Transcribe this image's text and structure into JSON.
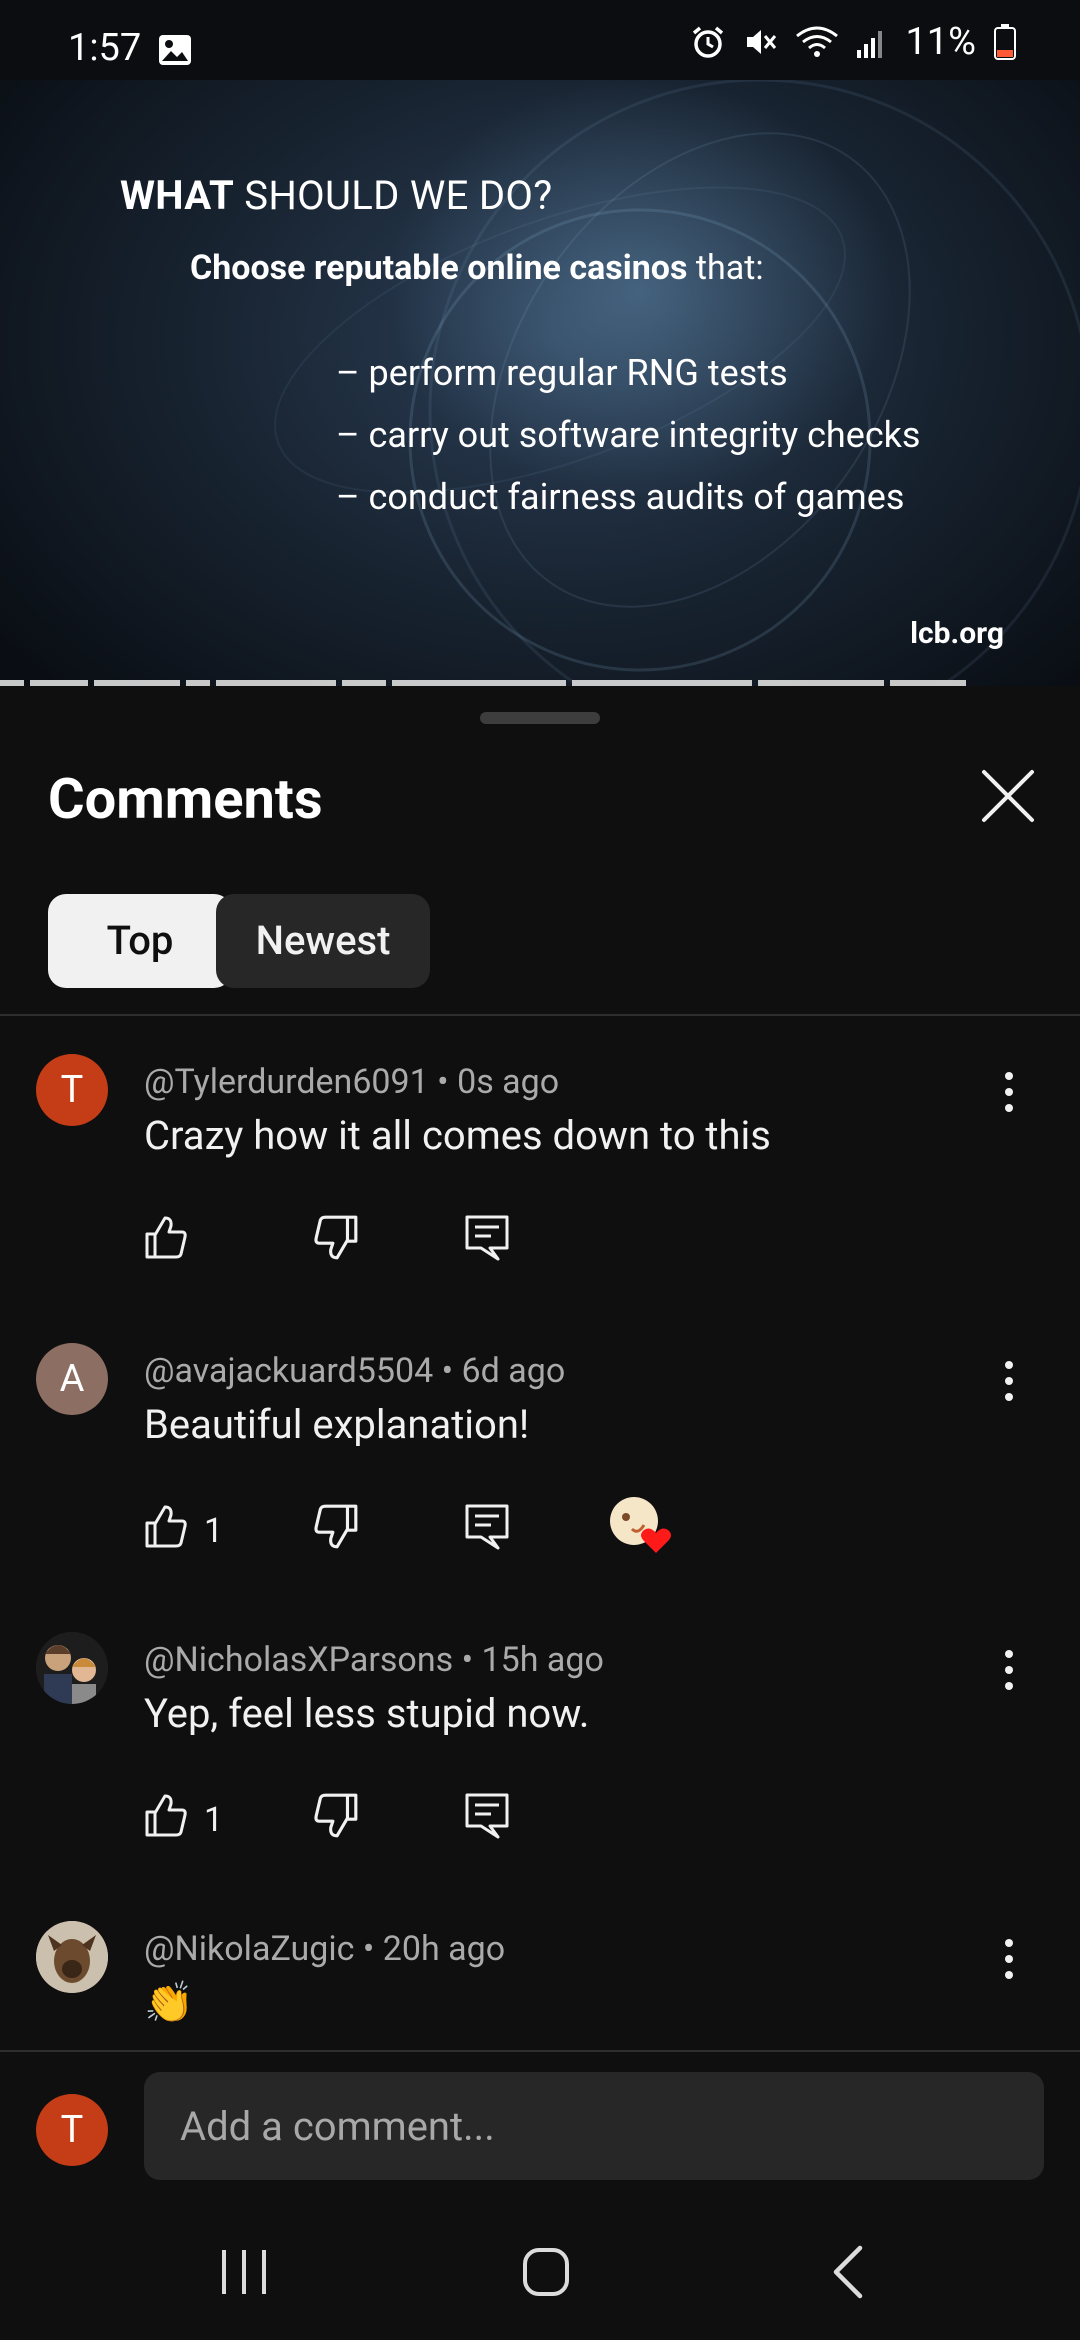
{
  "status_bar": {
    "time": "1:57",
    "battery": "11%",
    "icons": [
      "gallery-icon",
      "alarm-icon",
      "mute-icon",
      "wifi-icon",
      "signal-icon",
      "battery-icon"
    ],
    "battery_color": "#ff5a36"
  },
  "video": {
    "title_bold": "WHAT",
    "title_rest": " SHOULD WE DO?",
    "subtitle_bold": "Choose reputable online casinos",
    "subtitle_rest": " that:",
    "bullets": [
      "– perform regular RNG tests",
      "– carry out software integrity checks",
      "– conduct fairness audits of games"
    ],
    "brand": "lcb.org"
  },
  "comments_panel": {
    "title": "Comments",
    "tabs": [
      {
        "label": "Top",
        "selected": true
      },
      {
        "label": "Newest",
        "selected": false
      }
    ],
    "items": [
      {
        "avatar_letter": "T",
        "avatar_color": "#c43d17",
        "meta": "@Tylerdurden6091 • 0s ago",
        "text": "Crazy how it all comes down to this",
        "likes": "",
        "creator_heart": false
      },
      {
        "avatar_letter": "A",
        "avatar_color": "#8d6e63",
        "meta": "@avajackuard5504 • 6d ago",
        "text": "Beautiful explanation!",
        "likes": "1",
        "creator_heart": true
      },
      {
        "avatar_letter": "",
        "avatar_color": "#2a2a2a",
        "meta": "@NicholasXParsons • 15h ago",
        "text": "Yep, feel less stupid now.",
        "likes": "1",
        "creator_heart": false
      },
      {
        "avatar_letter": "",
        "avatar_color": "#b9a995",
        "meta": "@NikolaZugic • 20h ago",
        "text": "👏",
        "likes": "",
        "creator_heart": false
      }
    ]
  },
  "compose": {
    "avatar_letter": "T",
    "placeholder": "Add a comment..."
  },
  "nav_bar": {
    "buttons": [
      "recents-icon",
      "home-icon",
      "back-icon"
    ]
  }
}
